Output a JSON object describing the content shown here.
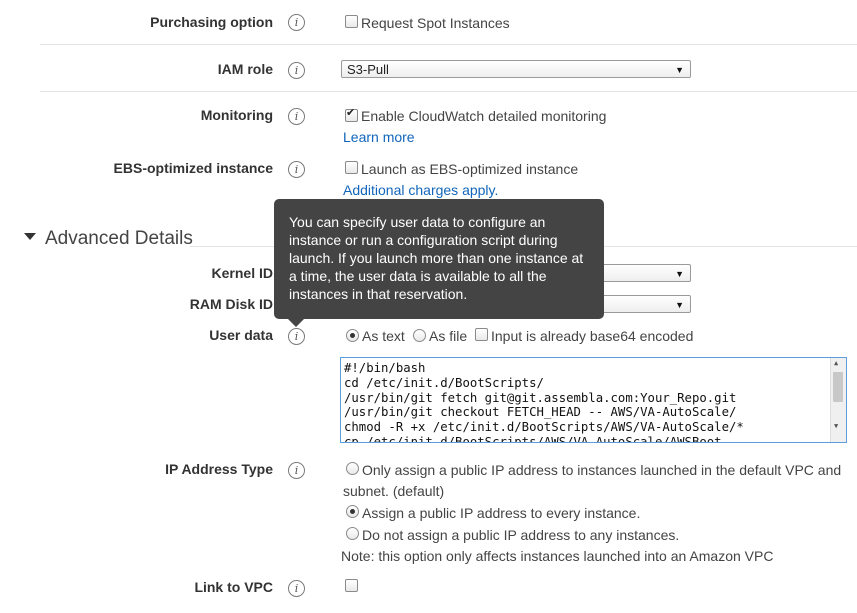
{
  "purchasing": {
    "label": "Purchasing option",
    "checkbox_label": "Request Spot Instances"
  },
  "iam": {
    "label": "IAM role",
    "selected": "S3-Pull"
  },
  "monitoring": {
    "label": "Monitoring",
    "checkbox_label": "Enable CloudWatch detailed monitoring",
    "link": "Learn more"
  },
  "ebs": {
    "label": "EBS-optimized instance",
    "checkbox_label": "Launch as EBS-optimized instance",
    "link": "Additional charges apply."
  },
  "advanced": {
    "title": "Advanced Details"
  },
  "kernel": {
    "label": "Kernel ID"
  },
  "ramdisk": {
    "label": "RAM Disk ID"
  },
  "userdata": {
    "label": "User data",
    "opt_text": "As text",
    "opt_file": "As file",
    "base64_label": "Input is already base64 encoded",
    "content": "#!/bin/bash\ncd /etc/init.d/BootScripts/\n/usr/bin/git fetch git@git.assembla.com:Your_Repo.git\n/usr/bin/git checkout FETCH_HEAD -- AWS/VA-AutoScale/\nchmod -R +x /etc/init.d/BootScripts/AWS/VA-AutoScale/*\ncp /etc/init.d/BootScripts/AWS/VA-AutoScale/AWSBoot"
  },
  "tooltip": {
    "text": "You can specify user data to configure an instance or run a configuration script during launch. If you launch more than one instance at a time, the user data is available to all the instances in that reservation."
  },
  "ip": {
    "label": "IP Address Type",
    "opt1_line1": "Only assign a public IP address to instances launched in the default VPC and",
    "opt1_line2": "subnet. (default)",
    "opt2": "Assign a public IP address to every instance.",
    "opt3": "Do not assign a public IP address to any instances.",
    "note": "Note: this option only affects instances launched into an Amazon VPC"
  },
  "vpc": {
    "label": "Link to VPC"
  }
}
